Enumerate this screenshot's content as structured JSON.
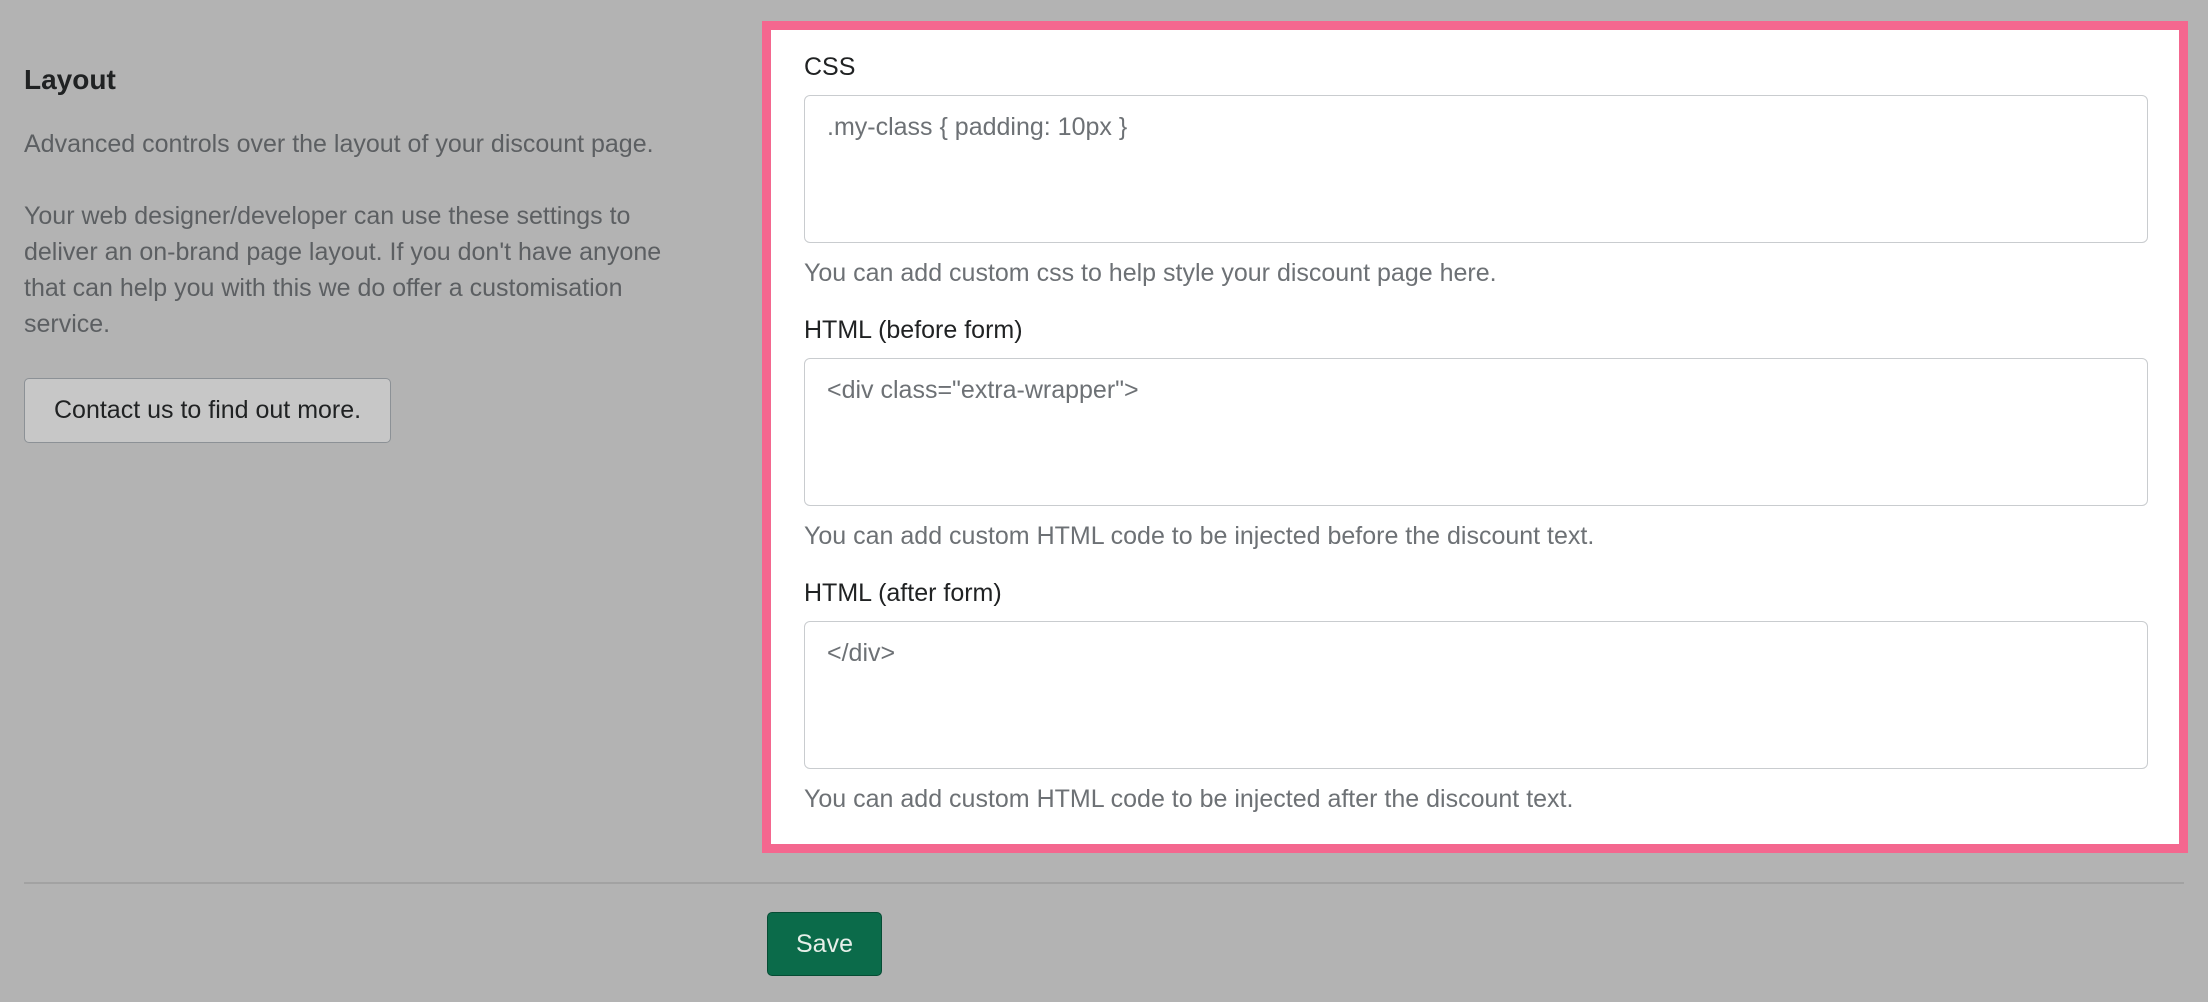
{
  "layout_section": {
    "title": "Layout",
    "description": "Advanced controls over the layout of your discount page.",
    "details": "Your web designer/developer can use these settings to deliver an on-brand page layout. If you don't have anyone that can help you with this we do offer a customisation service.",
    "contact_button": "Contact us to find out more."
  },
  "fields": {
    "css": {
      "label": "CSS",
      "placeholder": ".my-class { padding: 10px }",
      "value": "",
      "help": "You can add custom css to help style your discount page here."
    },
    "html_before": {
      "label": "HTML (before form)",
      "placeholder": "<div class=\"extra-wrapper\">",
      "value": "",
      "help": "You can add custom HTML code to be injected before the discount text."
    },
    "html_after": {
      "label": "HTML (after form)",
      "placeholder": "</div>",
      "value": "",
      "help": "You can add custom HTML code to be injected after the discount text."
    }
  },
  "footer": {
    "save_label": "Save"
  },
  "colors": {
    "highlight_border": "#f4678f",
    "primary_button": "#0b6b4a",
    "overlay_background": "#b3b3b3"
  }
}
